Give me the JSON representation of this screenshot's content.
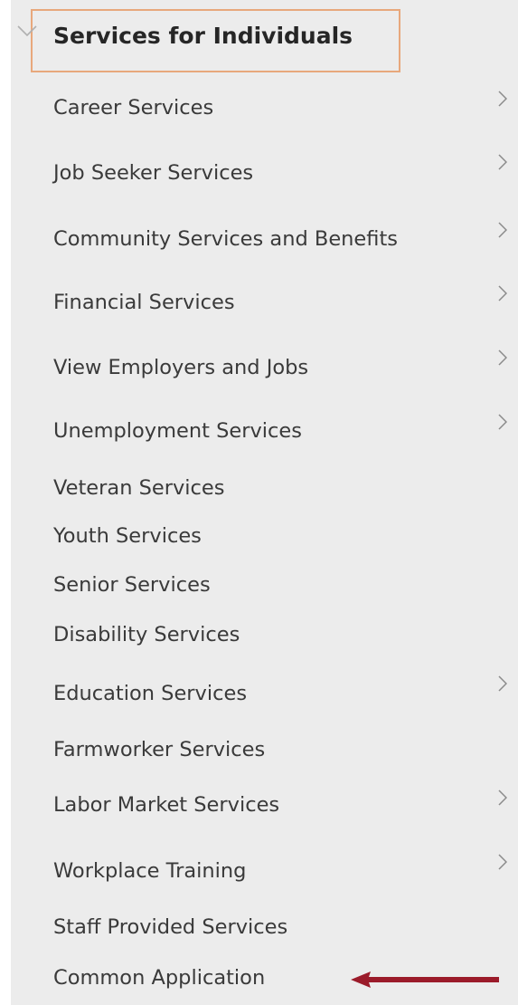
{
  "menu": {
    "header": {
      "title": "Services for Individuals",
      "icon": "chevron-down-icon",
      "expanded": true
    },
    "items": [
      {
        "label": "Career Services",
        "has_submenu": true
      },
      {
        "label": "Job Seeker Services",
        "has_submenu": true
      },
      {
        "label": "Community Services and Benefits",
        "has_submenu": true
      },
      {
        "label": "Financial Services",
        "has_submenu": true
      },
      {
        "label": "View Employers and Jobs",
        "has_submenu": true
      },
      {
        "label": "Unemployment Services",
        "has_submenu": true
      },
      {
        "label": "Veteran Services",
        "has_submenu": false
      },
      {
        "label": "Youth Services",
        "has_submenu": false
      },
      {
        "label": "Senior Services",
        "has_submenu": false
      },
      {
        "label": "Disability Services",
        "has_submenu": false
      },
      {
        "label": "Education Services",
        "has_submenu": true
      },
      {
        "label": "Farmworker Services",
        "has_submenu": false
      },
      {
        "label": "Labor Market Services",
        "has_submenu": true
      },
      {
        "label": "Workplace Training",
        "has_submenu": true
      },
      {
        "label": "Staff Provided Services",
        "has_submenu": false
      },
      {
        "label": "Common Application",
        "has_submenu": false
      }
    ]
  },
  "colors": {
    "panel_background": "#ececec",
    "header_focus_border": "#e8a87c",
    "text": "#3a3a3a",
    "chevron": "#8a8a8a",
    "annotation_arrow": "#9b1b2a"
  },
  "annotation": {
    "icon": "arrow-left-icon",
    "target": "Common Application"
  }
}
